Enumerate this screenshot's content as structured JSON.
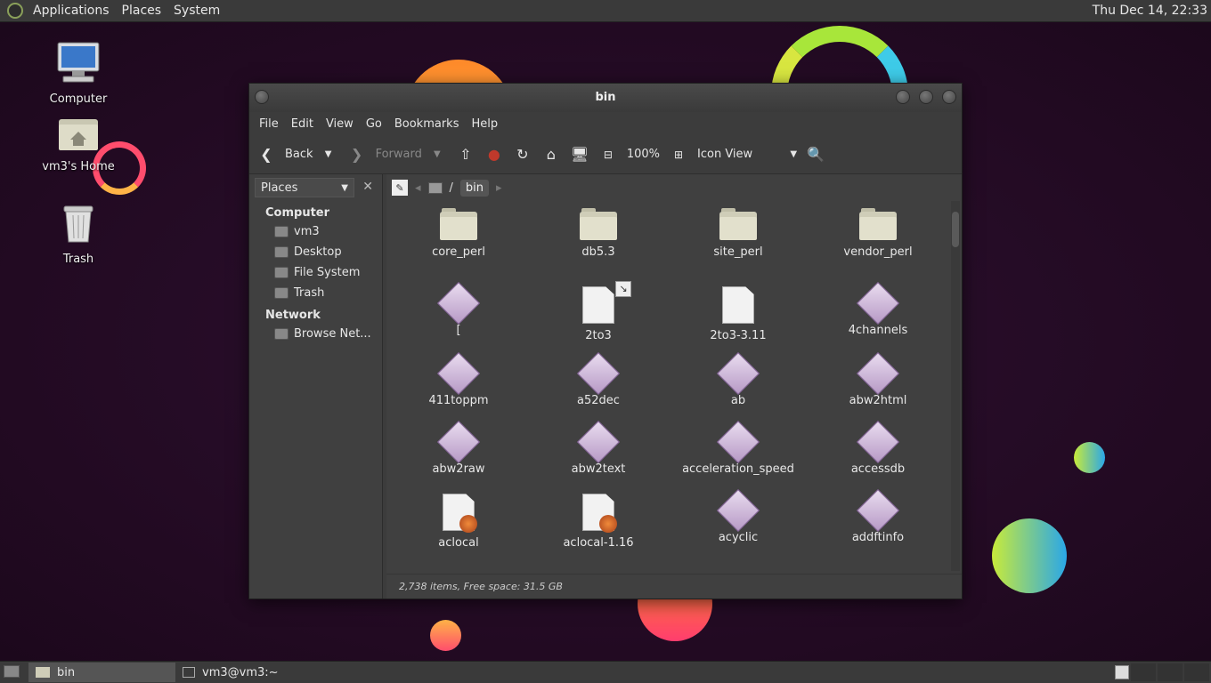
{
  "top_panel": {
    "menus": [
      "Applications",
      "Places",
      "System"
    ],
    "clock": "Thu Dec 14, 22:33"
  },
  "desktop": {
    "icons": [
      {
        "label": "Computer",
        "icon": "computer-icon"
      },
      {
        "label": "vm3's Home",
        "icon": "home-folder-icon"
      },
      {
        "label": "Trash",
        "icon": "trash-icon"
      }
    ]
  },
  "window": {
    "title": "bin",
    "menubar": [
      "File",
      "Edit",
      "View",
      "Go",
      "Bookmarks",
      "Help"
    ],
    "toolbar": {
      "back": "Back",
      "forward": "Forward",
      "zoom": "100%",
      "view_mode": "Icon View"
    },
    "sidebar": {
      "header": "Places",
      "sections": [
        {
          "title": "Computer",
          "items": [
            "vm3",
            "Desktop",
            "File System",
            "Trash"
          ]
        },
        {
          "title": "Network",
          "items": [
            "Browse Net..."
          ]
        }
      ]
    },
    "path": {
      "current": "bin",
      "separator": "/"
    },
    "files": [
      {
        "name": "core_perl",
        "type": "folder"
      },
      {
        "name": "db5.3",
        "type": "folder"
      },
      {
        "name": "site_perl",
        "type": "folder"
      },
      {
        "name": "vendor_perl",
        "type": "folder"
      },
      {
        "name": "[",
        "type": "exe"
      },
      {
        "name": "2to3",
        "type": "link"
      },
      {
        "name": "2to3-3.11",
        "type": "doc"
      },
      {
        "name": "4channels",
        "type": "exe"
      },
      {
        "name": "411toppm",
        "type": "exe"
      },
      {
        "name": "a52dec",
        "type": "exe"
      },
      {
        "name": "ab",
        "type": "exe"
      },
      {
        "name": "abw2html",
        "type": "exe"
      },
      {
        "name": "abw2raw",
        "type": "exe"
      },
      {
        "name": "abw2text",
        "type": "exe"
      },
      {
        "name": "acceleration_speed",
        "type": "exe"
      },
      {
        "name": "accessdb",
        "type": "exe"
      },
      {
        "name": "aclocal",
        "type": "script"
      },
      {
        "name": "aclocal-1.16",
        "type": "script"
      },
      {
        "name": "acyclic",
        "type": "exe"
      },
      {
        "name": "addftinfo",
        "type": "exe"
      }
    ],
    "status": "2,738 items, Free space: 31.5 GB"
  },
  "taskbar": {
    "tasks": [
      "bin",
      "vm3@vm3:~"
    ]
  }
}
